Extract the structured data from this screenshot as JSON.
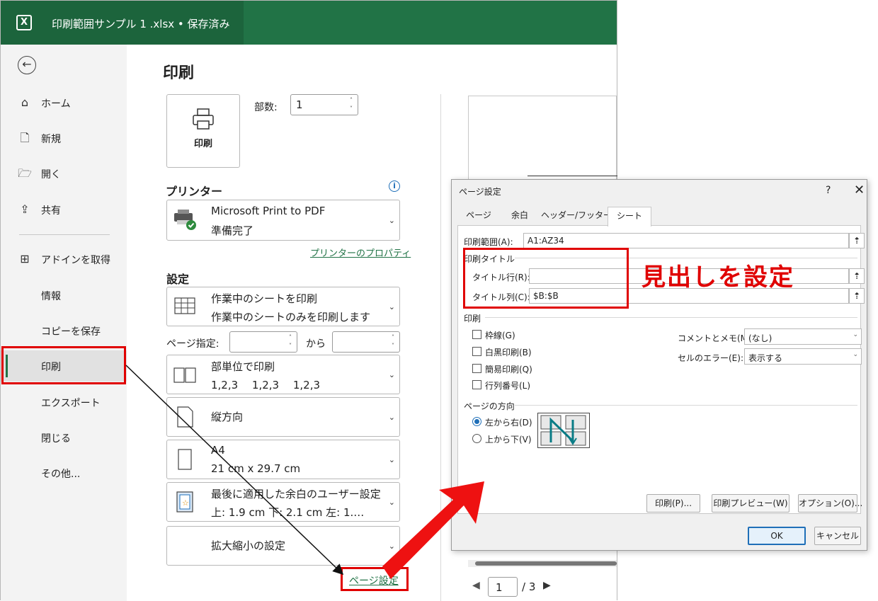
{
  "app": {
    "title": "印刷範囲サンプル 1 .xlsx • 保存済み",
    "logo": "X"
  },
  "sidebar": {
    "back": "←",
    "items": [
      {
        "label": "ホーム",
        "icon": "home-icon"
      },
      {
        "label": "新規",
        "icon": "new-file-icon"
      },
      {
        "label": "開く",
        "icon": "folder-open-icon"
      },
      {
        "label": "共有",
        "icon": "share-icon"
      },
      {
        "label": "アドインを取得",
        "icon": "addins-icon"
      },
      {
        "label": "情報"
      },
      {
        "label": "コピーを保存"
      },
      {
        "label": "印刷"
      },
      {
        "label": "エクスポート"
      },
      {
        "label": "閉じる"
      },
      {
        "label": "その他..."
      }
    ]
  },
  "print": {
    "title": "印刷",
    "print_button": "印刷",
    "copies_label": "部数:",
    "copies_value": "1",
    "printer_heading": "プリンター",
    "printer_name": "Microsoft Print to PDF",
    "printer_status": "準備完了",
    "printer_properties": "プリンターのプロパティ",
    "settings_heading": "設定",
    "settings": [
      {
        "line1": "作業中のシートを印刷",
        "line2": "作業中のシートのみを印刷します"
      },
      {
        "line1": "部単位で印刷",
        "line2": "1,2,3　 1,2,3　 1,2,3"
      },
      {
        "line1": "縦方向",
        "line2": ""
      },
      {
        "line1": "A4",
        "line2": "21 cm x 29.7 cm"
      },
      {
        "line1": "最後に適用した余白のユーザー設定",
        "line2": "上: 1.9 cm 下: 2.1 cm 左: 1.…"
      },
      {
        "line1": "拡大縮小の設定",
        "line2": ""
      }
    ],
    "pages_label": "ページ指定:",
    "pages_to": "から",
    "page_setup_link": "ページ設定",
    "preview_page": "1",
    "preview_total": "/ 3"
  },
  "dialog": {
    "title": "ページ設定",
    "help": "?",
    "close": "✕",
    "tabs": [
      "ページ",
      "余白",
      "ヘッダー/フッター",
      "シート"
    ],
    "print_area_label": "印刷範囲(A):",
    "print_area_value": "A1:AZ34",
    "print_titles_label": "印刷タイトル",
    "title_rows_label": "タイトル行(R):",
    "title_rows_value": "",
    "title_cols_label": "タイトル列(C):",
    "title_cols_value": "$B:$B",
    "print_group_label": "印刷",
    "checkboxes": [
      "枠線(G)",
      "白黒印刷(B)",
      "簡易印刷(Q)",
      "行列番号(L)"
    ],
    "comments_label": "コメントとメモ(M):",
    "comments_value": "(なし)",
    "errors_label": "セルのエラー(E):",
    "errors_value": "表示する",
    "order_label": "ページの方向",
    "order_options": [
      "左から右(D)",
      "上から下(V)"
    ],
    "buttons": {
      "print": "印刷(P)...",
      "preview": "印刷プレビュー(W)",
      "options": "オプション(O)...",
      "ok": "OK",
      "cancel": "キャンセル"
    }
  },
  "annotation": {
    "callout": "見出しを設定",
    "color": "#e00000"
  },
  "colors": {
    "brand": "#217346",
    "highlight": "#e00000",
    "accent": "#1f6fb8"
  }
}
